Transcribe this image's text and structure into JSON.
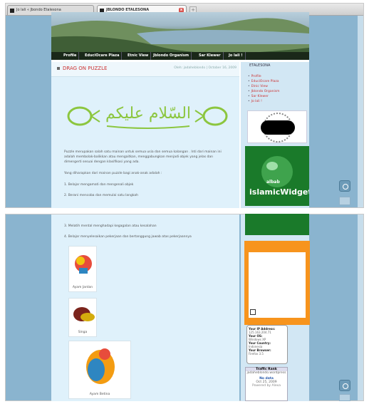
{
  "tabs": [
    {
      "label": "Jo lali « Jbondo Etalesona"
    },
    {
      "label": "JBLONDO ETALESONA"
    }
  ],
  "nav": [
    "Profile",
    "EduciOcare Plaza",
    "Etnic View",
    "Jblondo Organism",
    "Sar Klewer",
    "Jo lali !"
  ],
  "post": {
    "title": "DRAG ON PUZZLE",
    "meta": "Oleh: jadaheblondo | October 16, 2009",
    "calligraphy": "السّلام عليكم",
    "intro": "Puzzle merupakan salah satu mainan untuk semua usia dan semua kalangan . Inti dari mainan ini adalah membolak-balikkan atau mengaitkan, menggabungkan menjadi objek yang jelas dan dimengerti sesuai dengan klasifikasi yang ada.",
    "expect": "Yang diharapkan dari mainan puzzle bagi anak-anak adalah :",
    "points": [
      "1. Belajar mengamati dan mengenali objek",
      "2. Berani mencoba dan memulai satu langkah",
      "3. Melatih mental menghadapi kegagalan atau kesalahan",
      "4. Belajar menyelesaikan pekerjaan dan bertanggung jawab atas pekerjaannya"
    ]
  },
  "sidebar": {
    "title": "ETALESONA",
    "links": [
      "Profile",
      "EduciOcare Plaza",
      "Etnic View",
      "Jblondo Organism",
      "Sar Klewer",
      "Jo lali !"
    ],
    "widget_brand": "albab",
    "widget_title": "islamicWidget"
  },
  "thumbs": [
    {
      "caption": "Ayam Jantan"
    },
    {
      "caption": "Singa"
    },
    {
      "caption": "Ayam Betina"
    }
  ],
  "ipinfo": {
    "ip_label": "Your IP Address:",
    "ip": "125.163.204.71",
    "os_label": "Your OS:",
    "os": "Windows XP",
    "country_label": "Your Country:",
    "country": "Indonesia",
    "browser_label": "Your Browser:",
    "browser": "Firefox 3.5"
  },
  "rank": {
    "title": "Traffic Rank",
    "site": "jadaheblondo.wordpress",
    "value": "No data",
    "date": "Oct 25, 2009",
    "powered": "Powered by Alexa"
  }
}
